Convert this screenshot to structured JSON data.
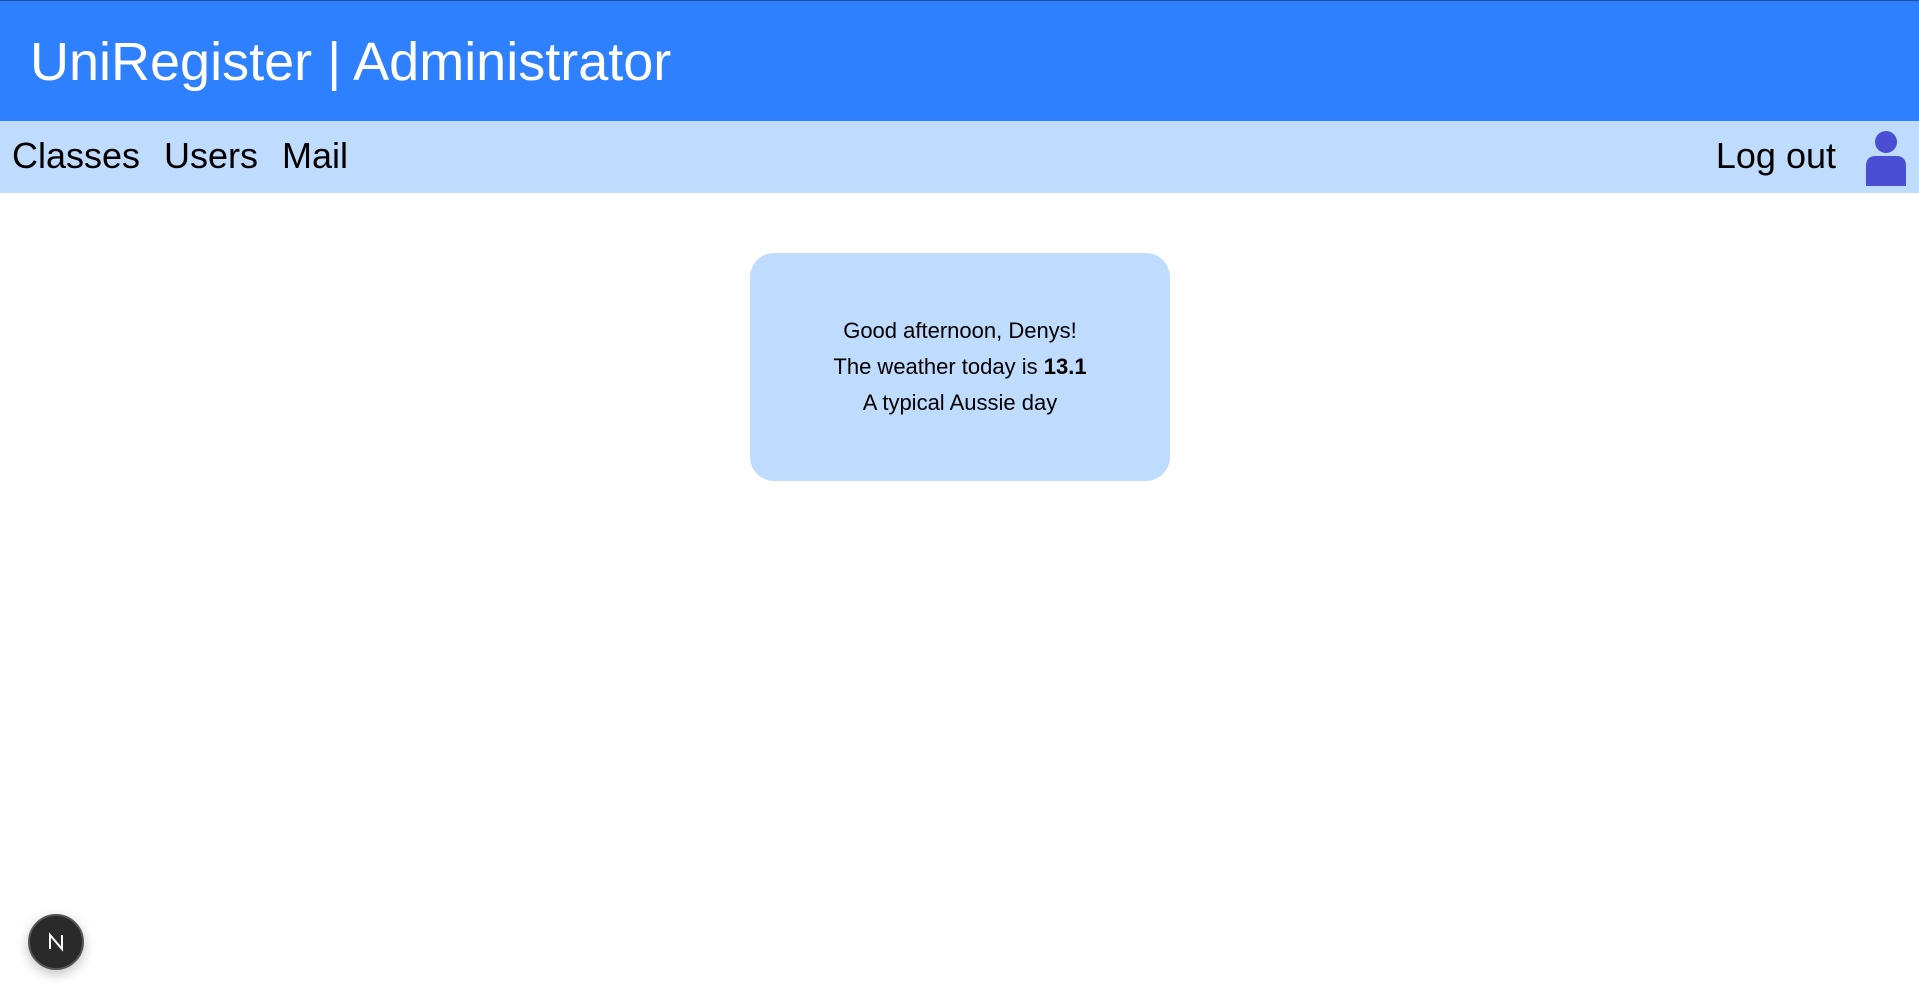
{
  "header": {
    "title": "UniRegister | Administrator"
  },
  "nav": {
    "items": [
      {
        "label": "Classes"
      },
      {
        "label": "Users"
      },
      {
        "label": "Mail"
      }
    ],
    "logout_label": "Log out",
    "profile_icon": "user-icon"
  },
  "welcome_card": {
    "greeting": "Good afternoon, Denys!",
    "weather_prefix": "The weather today is",
    "temperature": "13.1",
    "description": "A typical Aussie day"
  },
  "dev_badge": {
    "icon": "nextjs-logo-icon",
    "letter": "N"
  },
  "colors": {
    "header_bg": "#2f80ff",
    "nav_bg": "#bfdbfe",
    "card_bg": "#bfdbfe",
    "avatar": "#4a4ed4"
  }
}
